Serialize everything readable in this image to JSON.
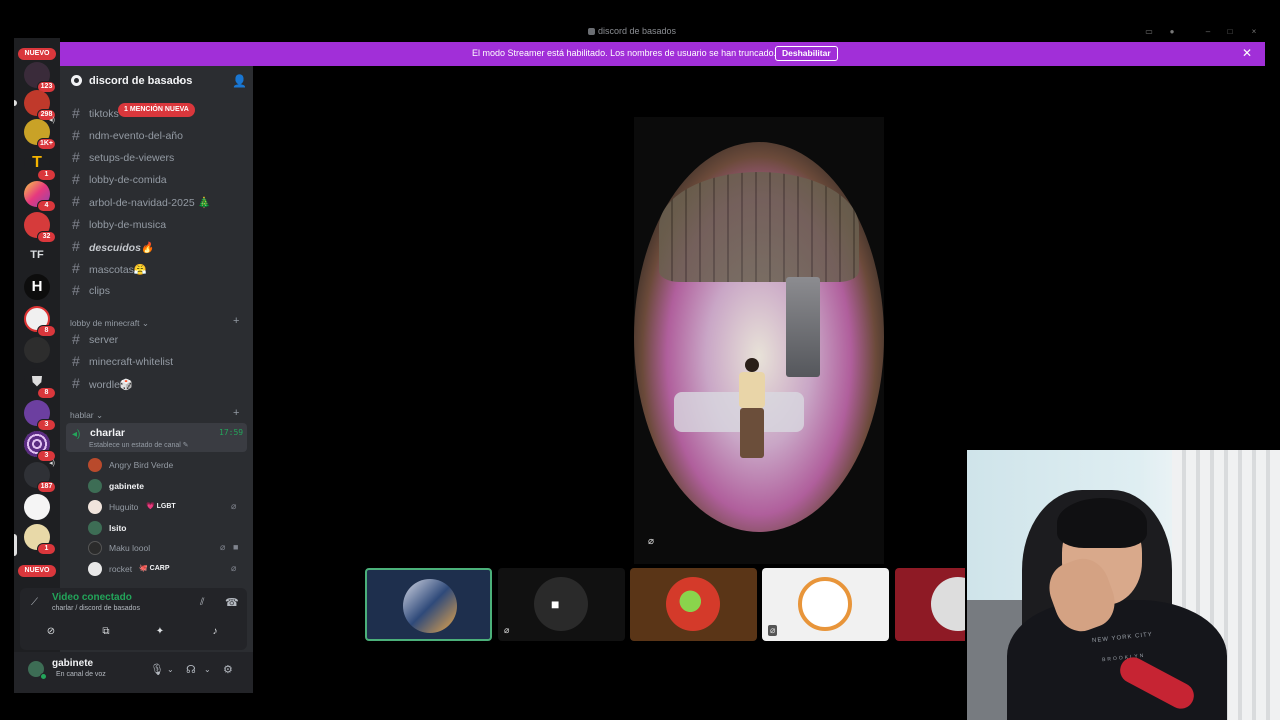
{
  "window": {
    "title": "discord de basados"
  },
  "banner": {
    "text": "El modo Streamer está habilitado. Los nombres de usuario se han truncado.",
    "button": "Deshabilitar",
    "color": "#a12fd8"
  },
  "rail": {
    "new_top": "NUEVO",
    "new_bottom": "NUEVO",
    "tf_label": "TF",
    "badges": [
      "123",
      "298",
      "1K+",
      "1",
      "4",
      "32",
      "8",
      "8",
      "3",
      "3",
      "187",
      "1"
    ]
  },
  "guild": {
    "name": "discord de basados"
  },
  "channels": {
    "mention_pill": "1 MENCIÓN NUEVA",
    "top": [
      "tiktoks",
      "ndm-evento-del-año",
      "setups-de-viewers",
      "lobby-de-comida",
      "arbol-de-navidad-2025 🎄",
      "lobby-de-musica",
      "descuidos🔥",
      "mascotas😤",
      "clips"
    ],
    "cat_minecraft": "lobby de minecraft",
    "minecraft": [
      "server",
      "minecraft-whitelist",
      "wordle🎲"
    ],
    "cat_hablar": "hablar"
  },
  "voice_channel": {
    "name": "charlar",
    "status": "Establece un estado de canal ✎",
    "time": "17:59",
    "users": [
      {
        "name": "Angry Bird Verde",
        "tag": ""
      },
      {
        "name": "gabinete",
        "tag": ""
      },
      {
        "name": "Huguito",
        "tag": "💗 LGBT"
      },
      {
        "name": "lsito",
        "tag": ""
      },
      {
        "name": "Maku loool",
        "tag": ""
      },
      {
        "name": "rocket",
        "tag": "🐙 CARP"
      }
    ]
  },
  "voice_panel": {
    "title": "Video conectado",
    "subtitle": "charlar / discord de basados"
  },
  "user": {
    "name": "gabinete",
    "status": "En canal de voz"
  },
  "webcam": {
    "hoodie_text_1": "NEW YORK CITY",
    "hoodie_text_2": "BROOKLYN"
  },
  "colors": {
    "accent_green": "#23a55a",
    "badge_red": "#da373c",
    "sidebar": "#2b2d31",
    "rail": "#1e1f22"
  }
}
